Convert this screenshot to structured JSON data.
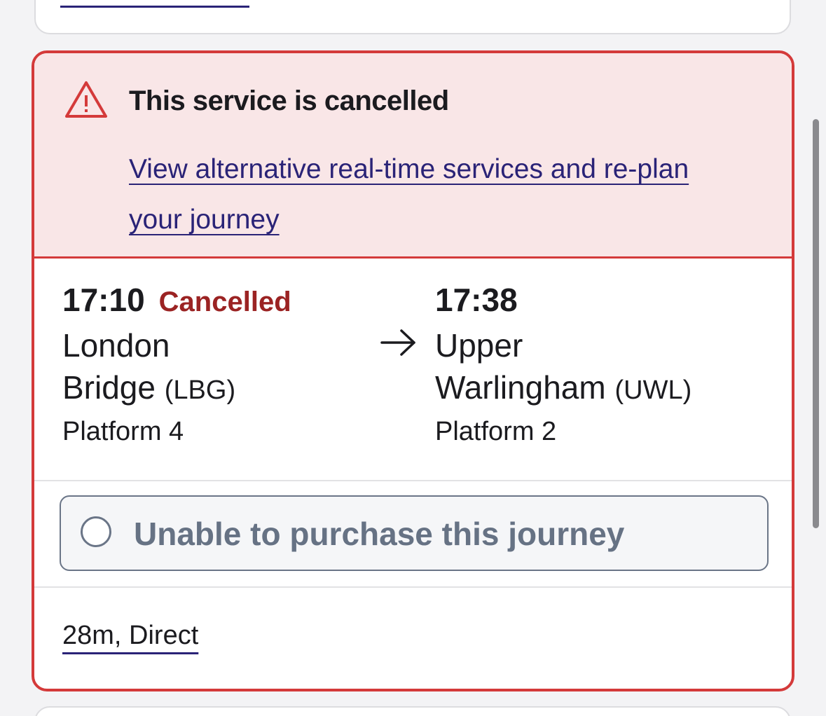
{
  "alert": {
    "title": "This service is cancelled",
    "link_text": "View alternative real-time services and re-plan your journey",
    "icon": "warning-triangle-icon",
    "color": "#d43a3a",
    "background": "#f9e6e7"
  },
  "departure": {
    "time": "17:10",
    "status": "Cancelled",
    "station_name_line1": "London",
    "station_name_line2": "Bridge",
    "station_code": "(LBG)",
    "platform": "Platform 4"
  },
  "arrival": {
    "time": "17:38",
    "station_name_line1": "Upper",
    "station_name_line2": "Warlingham",
    "station_code": "(UWL)",
    "platform": "Platform 2"
  },
  "purchase": {
    "label": "Unable to purchase this journey"
  },
  "journey": {
    "duration_label": "28m, Direct"
  },
  "colors": {
    "link": "#2a2377",
    "cancelled_status": "#9b2323",
    "disabled_text": "#667284"
  }
}
